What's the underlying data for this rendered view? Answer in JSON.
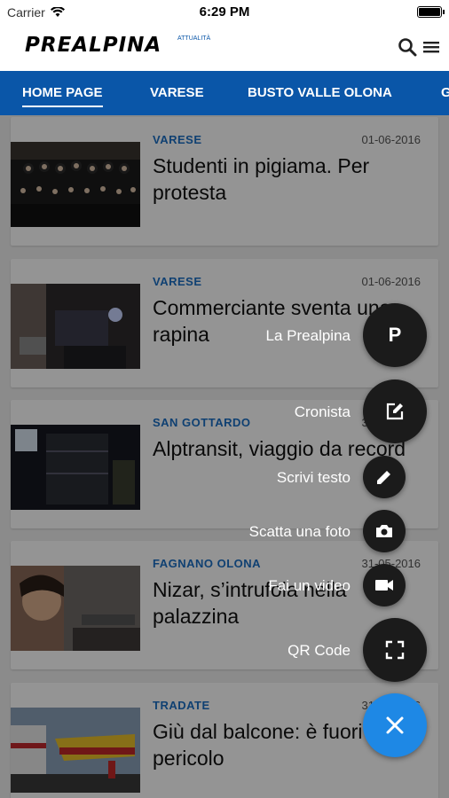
{
  "status": {
    "carrier": "Carrier",
    "time": "6:29 PM"
  },
  "header": {
    "logo": "PREALPINA",
    "logo_sup": "ATTUALITÀ"
  },
  "nav": {
    "tabs": [
      "HOME PAGE",
      "VARESE",
      "BUSTO VALLE OLONA",
      "G"
    ]
  },
  "articles": [
    {
      "category": "VARESE",
      "date": "01-06-2016",
      "title": "Studenti in pigiama. Per protesta"
    },
    {
      "category": "VARESE",
      "date": "01-06-2016",
      "title": "Commerciante sventa una rapina"
    },
    {
      "category": "SAN GOTTARDO",
      "date": "31-05-2016",
      "title": "Alptransit, viaggio da record"
    },
    {
      "category": "FAGNANO OLONA",
      "date": "31-05-2016",
      "title": "Nizar, s’intrufola nella palazzina"
    },
    {
      "category": "TRADATE",
      "date": "31-05-2016",
      "title": "Giù dal balcone: è fuori pericolo"
    }
  ],
  "menu": {
    "items": [
      {
        "label": "La Prealpina",
        "glyph": "P"
      },
      {
        "label": "Cronista"
      },
      {
        "label": "Scrivi testo"
      },
      {
        "label": "Scatta una foto"
      },
      {
        "label": "Fai un video"
      },
      {
        "label": "QR Code"
      }
    ]
  },
  "colors": {
    "brand": "#0a56a8",
    "accent": "#1e88e5"
  }
}
